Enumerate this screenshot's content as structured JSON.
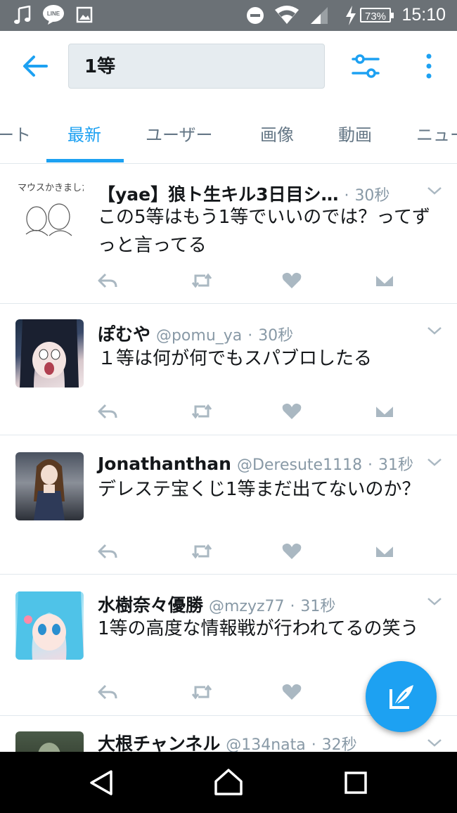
{
  "status_bar": {
    "time": "15:10",
    "battery": "73%",
    "icons": [
      "music-note-icon",
      "line-app-icon",
      "image-icon",
      "do-not-disturb-icon",
      "wifi-icon",
      "cell-signal-icon",
      "charging-bolt-icon"
    ]
  },
  "header": {
    "search_value": "1等",
    "back_icon": "arrow-left-icon",
    "filter_icon": "filter-sliders-icon",
    "more_icon": "more-vertical-icon"
  },
  "tabs": [
    {
      "label": "ート",
      "active": false
    },
    {
      "label": "最新",
      "active": true
    },
    {
      "label": "ユーザー",
      "active": false
    },
    {
      "label": "画像",
      "active": false
    },
    {
      "label": "動画",
      "active": false
    },
    {
      "label": "ニュー",
      "active": false
    }
  ],
  "tweets": [
    {
      "name": "【yae】狼ト生キル3日目シ…",
      "handle": "",
      "time": "30秒",
      "text": "この5等はもう1等でいいのでは？ってずっと言ってる",
      "avatar_text": "マウスかきました!"
    },
    {
      "name": "ぽむや",
      "handle": "@pomu_ya",
      "time": "30秒",
      "text": "１等は何が何でもスパブロしたる"
    },
    {
      "name": "Jonathanthan",
      "handle": "@Deresute1118",
      "time": "31秒",
      "text": "デレステ宝くじ1等まだ出てないのか？"
    },
    {
      "name": "水樹奈々優勝",
      "handle": "@mzyz77",
      "time": "31秒",
      "text": "1等の高度な情報戦が行われてるの笑う"
    },
    {
      "name": "大根チャンネル",
      "handle": "@134nata",
      "time": "32秒",
      "text": ""
    }
  ],
  "tweet_separator": "·",
  "colors": {
    "accent": "#1da1f2",
    "status_bar": "#6b7176",
    "muted": "#8899a6",
    "action": "#aab8c2"
  }
}
